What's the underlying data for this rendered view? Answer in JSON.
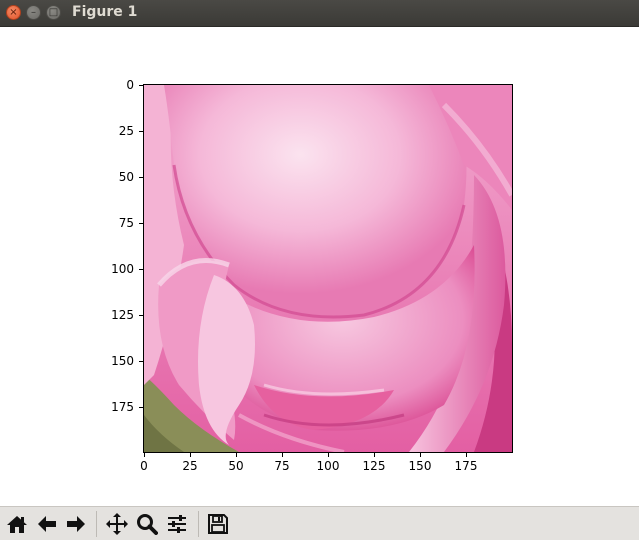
{
  "window": {
    "title": "Figure 1",
    "close_glyph": "×",
    "minimize_glyph": "–",
    "maximize_glyph": "□"
  },
  "plot": {
    "type": "image",
    "image_description": "pink rose petals close-up",
    "x_ticks": [
      "0",
      "25",
      "50",
      "75",
      "100",
      "125",
      "150",
      "175"
    ],
    "y_ticks": [
      "0",
      "25",
      "50",
      "75",
      "100",
      "125",
      "150",
      "175"
    ]
  },
  "toolbar": {
    "buttons": [
      {
        "name": "home-icon"
      },
      {
        "name": "back-arrow-icon"
      },
      {
        "name": "forward-arrow-icon"
      },
      {
        "name": "pan-icon"
      },
      {
        "name": "zoom-icon"
      },
      {
        "name": "subplots-config-icon"
      },
      {
        "name": "save-icon"
      }
    ]
  },
  "colors": {
    "titlebar": "#3c3b37",
    "close_button": "#e95420",
    "petal_light": "#f6c6e0",
    "petal_mid": "#ee8fc0",
    "petal_dark": "#d94a95",
    "background_green": "#8a8e58",
    "toolbar_bg": "#e4e2df"
  }
}
